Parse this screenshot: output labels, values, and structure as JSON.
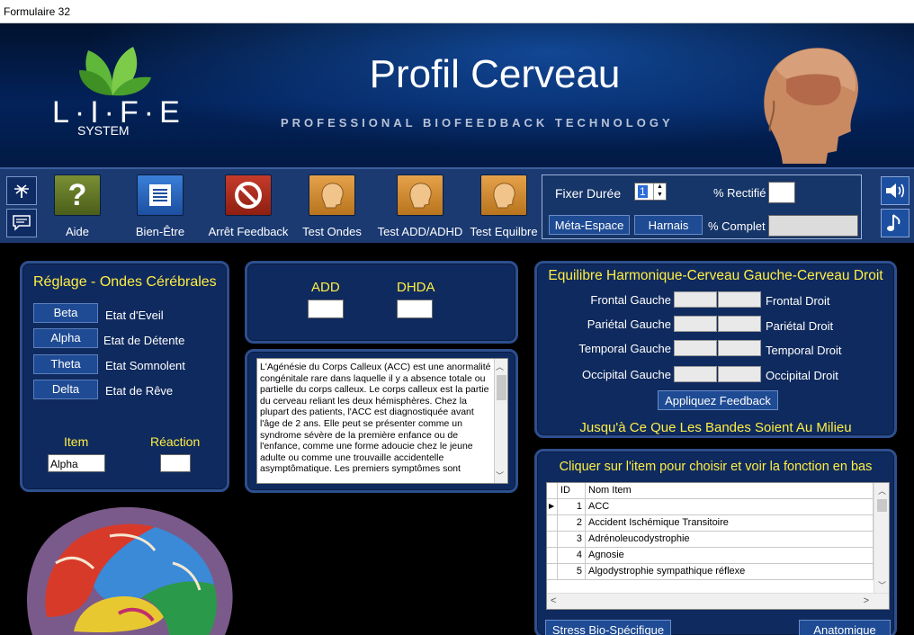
{
  "window": {
    "title": "Formulaire 32"
  },
  "header": {
    "title": "Profil Cerveau",
    "subtitle": "PROFESSIONAL BIOFEEDBACK TECHNOLOGY",
    "logo_text": "L·I·F·E",
    "logo_subtext": "SYSTEM"
  },
  "toolbar": {
    "side_icons": [
      "antenna-icon",
      "chat-icon"
    ],
    "tools": [
      {
        "label": "Aide",
        "icon": "question-icon",
        "color": "#6b8a2a"
      },
      {
        "label": "Bien-Être",
        "icon": "list-icon",
        "color": "#2a6bc8"
      },
      {
        "label": "Arrêt Feedback",
        "icon": "stop-icon",
        "color": "#b0301f"
      },
      {
        "label": "Test Ondes",
        "icon": "head-icon",
        "color": "#d88f34"
      },
      {
        "label": "Test ADD/ADHD",
        "icon": "head-icon",
        "color": "#d88f34"
      },
      {
        "label": "Test Equilbre",
        "icon": "head-icon",
        "color": "#d88f34"
      }
    ],
    "duration_label": "Fixer Durée",
    "duration_value": "1",
    "rectifie_label": "% Rectifié",
    "rectifie_value": "",
    "complet_label": "% Complet",
    "complet_value": "",
    "meta_button": "Méta-Espace",
    "harnais_button": "Harnais",
    "right_icons": [
      "speaker-icon",
      "music-note-icon"
    ]
  },
  "waves_panel": {
    "title": "Réglage  - Ondes Cérébrales",
    "rows": [
      {
        "button": "Beta",
        "label": "Etat d'Eveil"
      },
      {
        "button": "Alpha",
        "label": "Etat de Détente"
      },
      {
        "button": "Theta",
        "label": "Etat Somnolent"
      },
      {
        "button": "Delta",
        "label": "Etat de Rêve"
      }
    ],
    "item_label": "Item",
    "item_value": "Alpha",
    "reaction_label": "Réaction",
    "reaction_value": ""
  },
  "add_panel": {
    "add_label": "ADD",
    "add_value": "",
    "dhda_label": "DHDA",
    "dhda_value": ""
  },
  "description": {
    "text": "L'Agénésie du Corps Calleux  (ACC) est une anormalité congénitale rare dans laquelle il y a absence totale ou partielle du corps calleux.  Le corps calleux est la partie du cerveau reliant les deux hémisphères.  Chez la plupart des patients, l'ACC est diagnostiquée avant l'âge de 2 ans. Elle peut se présenter comme un syndrome sévère de la première enfance ou de l'enfance, comme une forme adoucie chez le jeune adulte ou comme une trouvaille accidentelle asymptômatique.  Les premiers symptômes sont"
  },
  "balance_panel": {
    "title": "Equilibre Harmonique-Cerveau Gauche-Cerveau Droit",
    "rows": [
      {
        "left": "Frontal Gauche",
        "right": "Frontal Droit"
      },
      {
        "left": "Pariétal Gauche",
        "right": "Pariétal Droit"
      },
      {
        "left": "Temporal Gauche",
        "right": "Temporal Droit"
      },
      {
        "left": "Occipital Gauche",
        "right": "Occipital Droit"
      }
    ],
    "apply_button": "Appliquez Feedback",
    "footer": "Jusqu'à Ce Que Les Bandes Soient Au Milieu"
  },
  "items_panel": {
    "title": "Cliquer sur l'item pour choisir et voir la fonction en bas",
    "columns": [
      "ID",
      "Nom Item"
    ],
    "rows": [
      {
        "id": "1",
        "name": "ACC"
      },
      {
        "id": "2",
        "name": "Accident Ischémique Transitoire"
      },
      {
        "id": "3",
        "name": "Adrénoleucodystrophie"
      },
      {
        "id": "4",
        "name": "Agnosie"
      },
      {
        "id": "5",
        "name": "Algodystrophie sympathique réflexe"
      }
    ]
  },
  "bottom_buttons": {
    "stress": "Stress Bio-Spécifique",
    "anatomique": "Anatomique"
  }
}
